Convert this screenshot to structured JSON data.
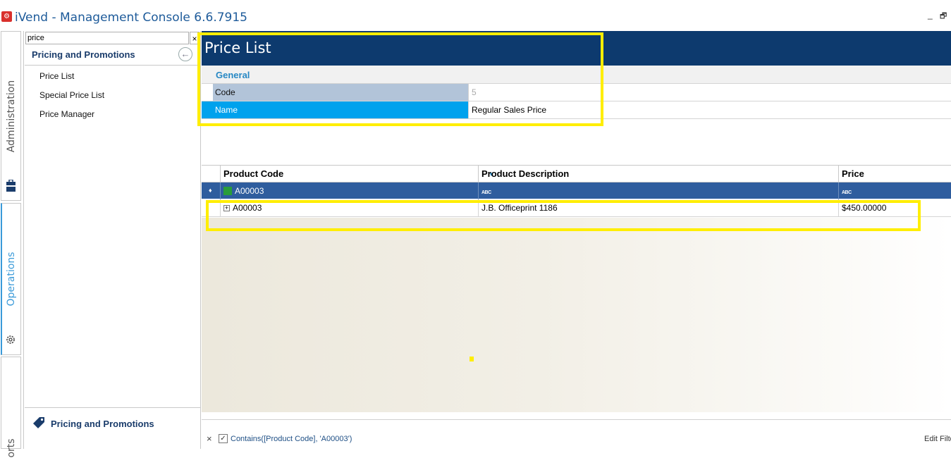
{
  "app": {
    "title": "iVend - Management Console  6.6.7915",
    "logo_glyph": "⚙"
  },
  "window": {
    "minimize": "_",
    "restore": "🗗"
  },
  "vtabs": [
    {
      "label": "Administration",
      "icon": "briefcase-icon"
    },
    {
      "label": "Operations",
      "icon": "gear-icon"
    },
    {
      "label": "orts",
      "icon": "reports-icon"
    }
  ],
  "nav": {
    "search": {
      "value": "price",
      "clear": "×"
    },
    "group_title": "Pricing and Promotions",
    "back_glyph": "←",
    "items": [
      {
        "label": "Price List"
      },
      {
        "label": "Special Price List"
      },
      {
        "label": "Price Manager"
      }
    ],
    "bottom_label": "Pricing and Promotions"
  },
  "main": {
    "title": "Price List",
    "section": "General",
    "properties": [
      {
        "name": "Code",
        "value": "5"
      },
      {
        "name": "Name",
        "value": "Regular Sales Price"
      }
    ],
    "grid": {
      "columns": [
        "Product Code",
        "Product Description",
        "Price"
      ],
      "filter_row": {
        "code": "A00003",
        "abc": "ABC"
      },
      "rows": [
        {
          "code": "A00003",
          "description": "J.B. Officeprint 1186",
          "price": "$450.00000"
        }
      ]
    },
    "filter_bar": {
      "close": "×",
      "check": "✓",
      "text": "Contains([Product Code], 'A00003')",
      "edit": "Edit Filter"
    }
  },
  "colors": {
    "accent": "#0d3a6e",
    "selection": "#00a2ed",
    "highlight": "#ffee00"
  }
}
